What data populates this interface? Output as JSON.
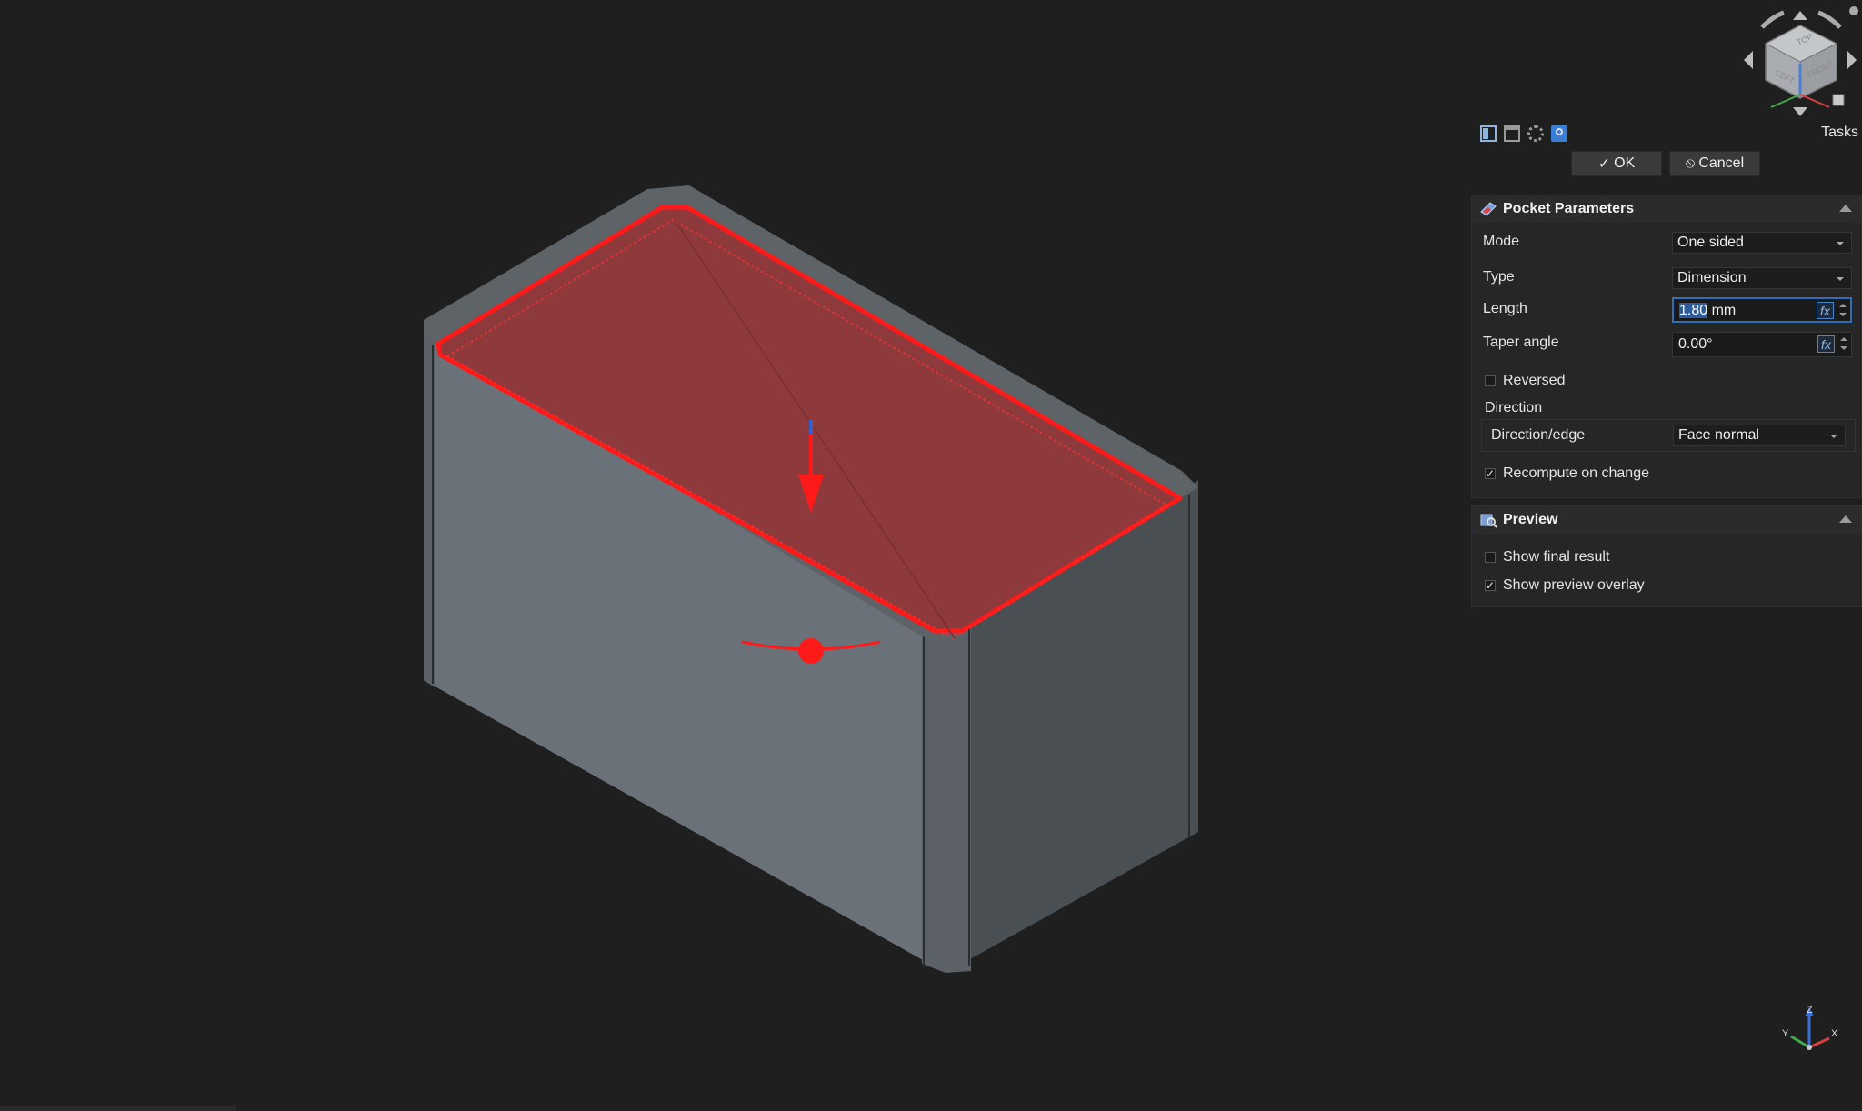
{
  "toolbar": {
    "tasks_label": "Tasks",
    "icons": [
      "model-tab-icon",
      "property-view-icon",
      "settings-icon",
      "tasks-tab-icon"
    ]
  },
  "buttons": {
    "ok_label": "OK",
    "cancel_label": "Cancel"
  },
  "pocket": {
    "title": "Pocket Parameters",
    "mode_label": "Mode",
    "mode_value": "One sided",
    "type_label": "Type",
    "type_value": "Dimension",
    "length_label": "Length",
    "length_value": "1.80",
    "length_unit": "mm",
    "taper_label": "Taper angle",
    "taper_value": "0.00°",
    "reversed_label": "Reversed",
    "reversed_checked": false,
    "direction_label": "Direction",
    "direction_edge_label": "Direction/edge",
    "direction_edge_value": "Face normal",
    "recompute_label": "Recompute on change",
    "recompute_checked": true
  },
  "preview": {
    "title": "Preview",
    "show_final_label": "Show final result",
    "show_final_checked": false,
    "show_overlay_label": "Show preview overlay",
    "show_overlay_checked": true
  },
  "navcube": {
    "faces": [
      "TOP",
      "LEFT",
      "FRONT"
    ]
  },
  "axis": {
    "labels": [
      "Z",
      "Y",
      "X"
    ]
  },
  "colors": {
    "accent": "#2e6fb8",
    "highlight": "#ff0000",
    "background": "#1f1f1f",
    "model": "#6b7178"
  }
}
